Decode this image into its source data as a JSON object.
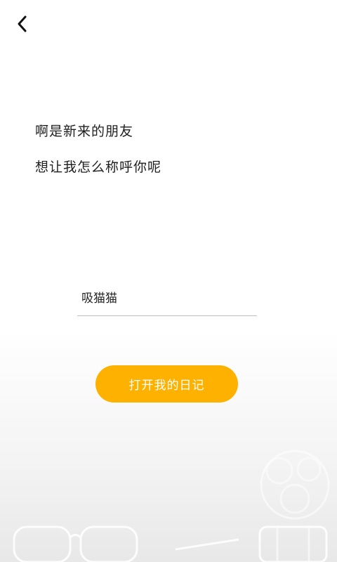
{
  "header": {
    "back_icon": "chevron-left-icon"
  },
  "greeting": {
    "line1": "啊是新来的朋友",
    "line2": "想让我怎么称呼你呢"
  },
  "name_input": {
    "value": "吸猫猫"
  },
  "open_button": {
    "label": "打开我的日记",
    "color": "#FFB100"
  },
  "decor": {
    "background_icons": [
      "glasses-icon",
      "plant-icon",
      "pen-icon",
      "glass-jar-icon"
    ]
  }
}
